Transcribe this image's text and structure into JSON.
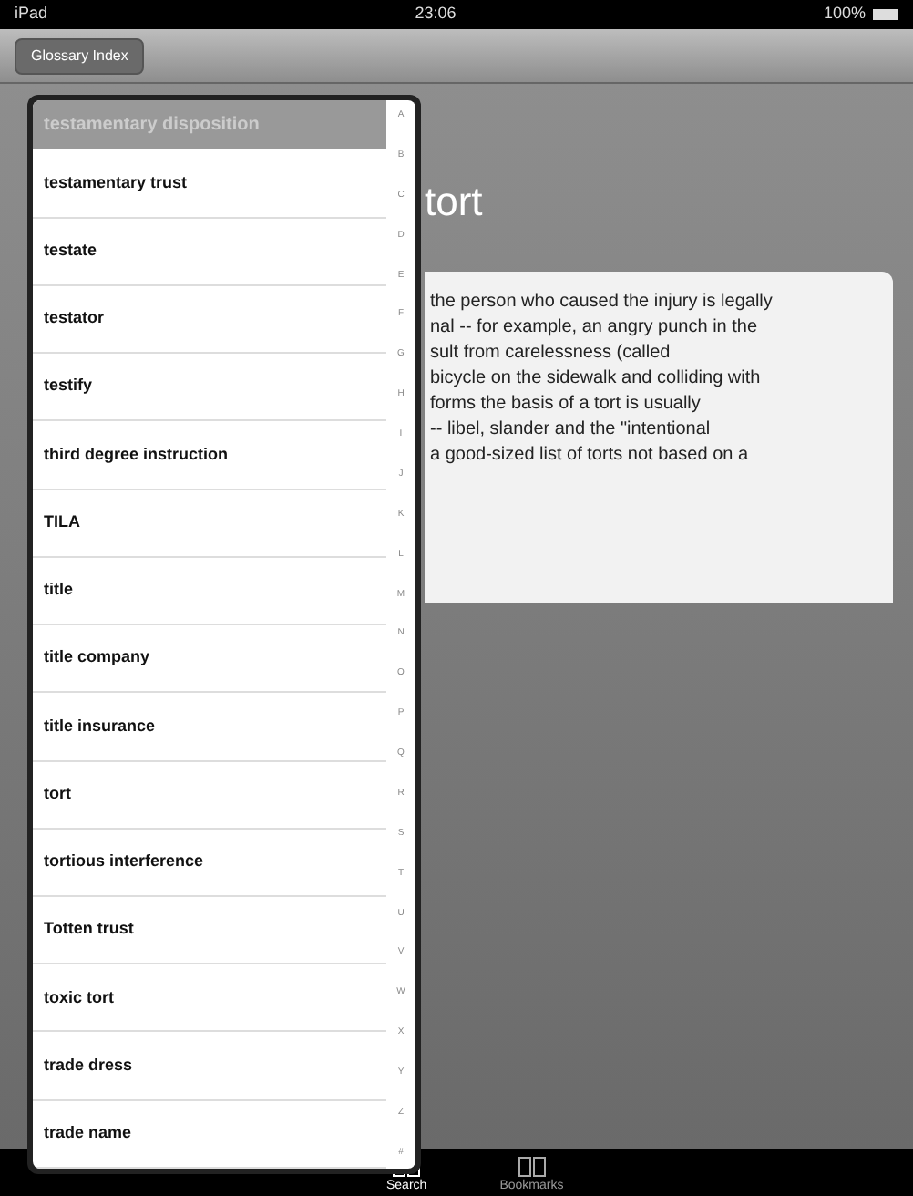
{
  "status_bar": {
    "device": "iPad",
    "time": "23:06",
    "battery": "100%"
  },
  "toolbar": {
    "button": "Glossary Index"
  },
  "entry": {
    "title": "tort",
    "lines": [
      "the person who caused the injury is legally",
      "nal -- for example, an angry punch in the",
      "sult from carelessness (called",
      "bicycle on the sidewalk and colliding with",
      "forms the basis of a tort is usually",
      "-- libel, slander and the \"intentional",
      "a good-sized list of torts not based on a"
    ]
  },
  "glossary": {
    "partial_item": "testamentary disposition",
    "items": [
      "testamentary trust",
      "testate",
      "testator",
      "testify",
      "third degree instruction",
      "TILA",
      "title",
      "title company",
      "title insurance",
      "tort",
      "tortious interference",
      "Totten trust",
      "toxic tort",
      "trade dress",
      "trade name"
    ],
    "index": [
      "A",
      "B",
      "C",
      "D",
      "E",
      "F",
      "G",
      "H",
      "I",
      "J",
      "K",
      "L",
      "M",
      "N",
      "O",
      "P",
      "Q",
      "R",
      "S",
      "T",
      "U",
      "V",
      "W",
      "X",
      "Y",
      "Z",
      "#"
    ]
  },
  "tab_bar": [
    {
      "label": "Search",
      "selected": true
    },
    {
      "label": "Bookmarks",
      "selected": false
    }
  ]
}
